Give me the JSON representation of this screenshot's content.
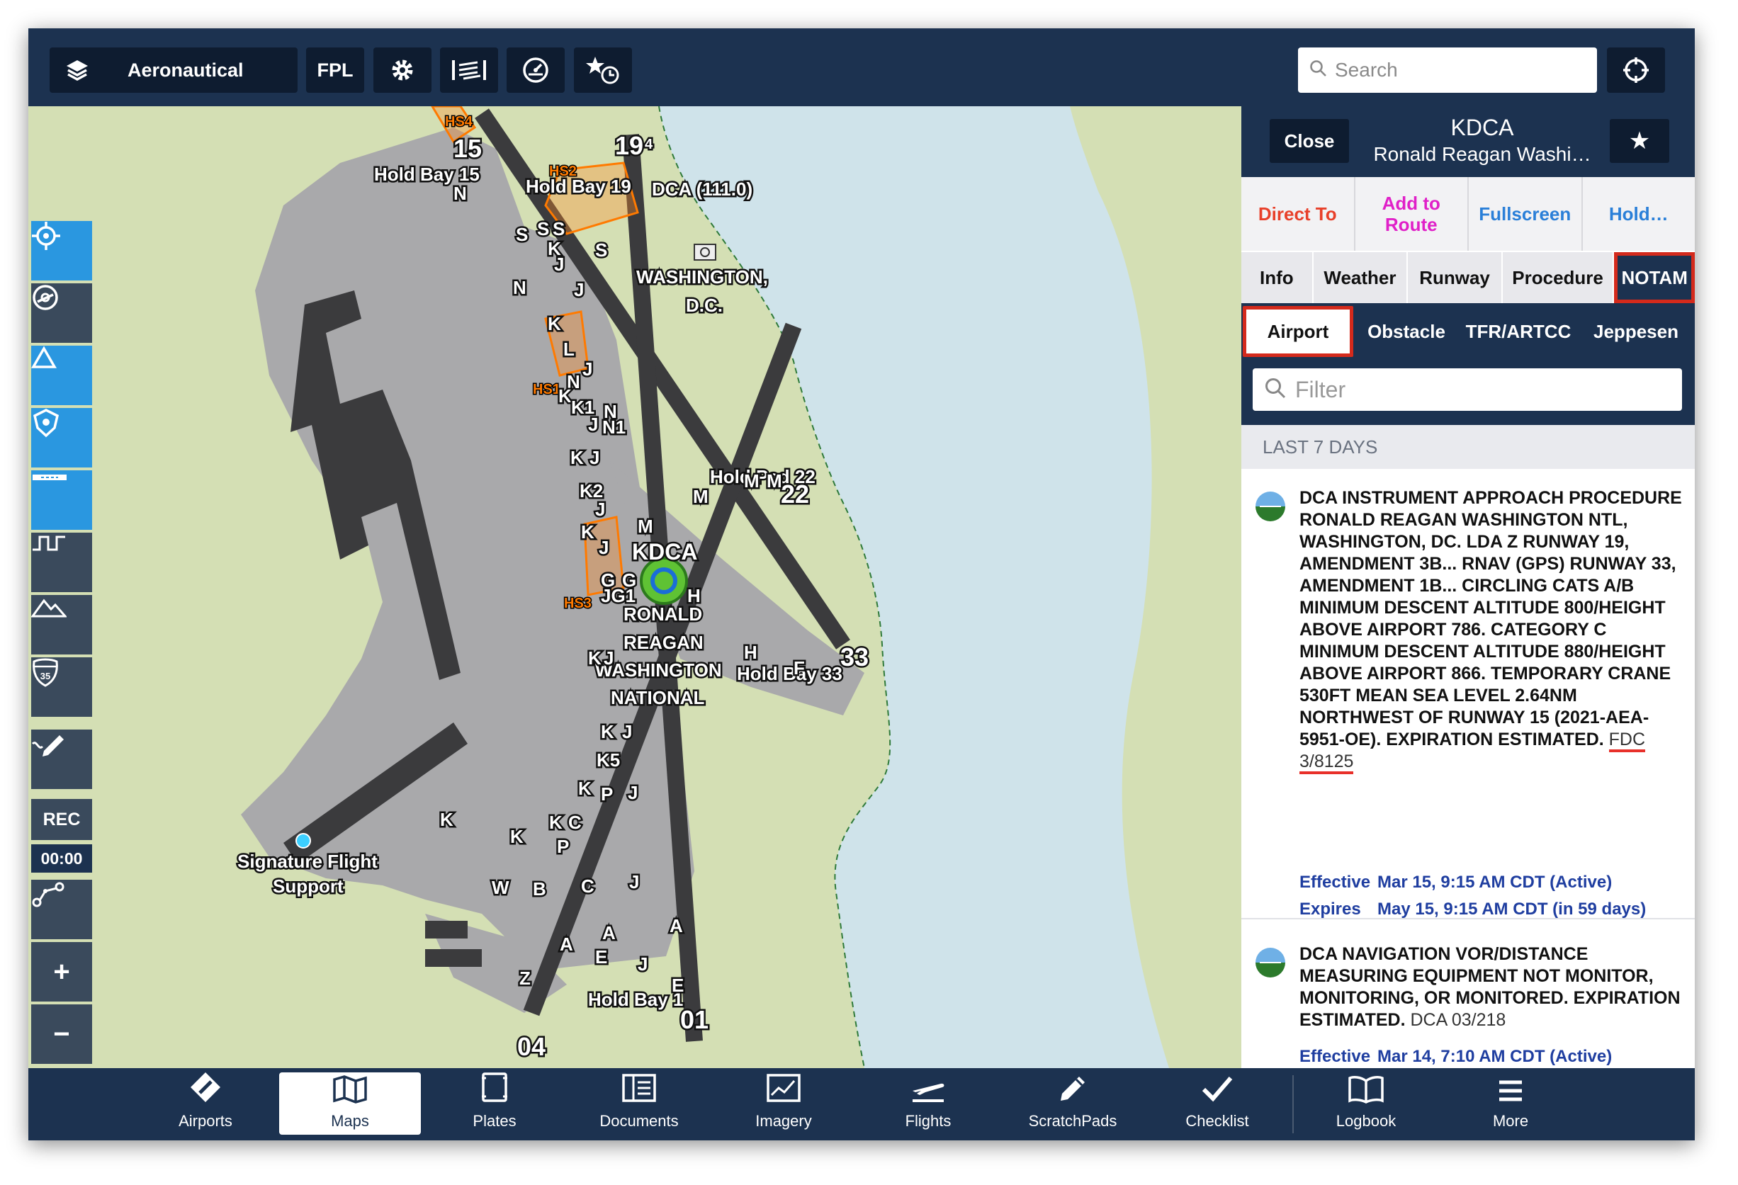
{
  "topbar": {
    "layer_label": "Aeronautical",
    "fpl_label": "FPL",
    "search_placeholder": "Search"
  },
  "map": {
    "labels": {
      "hold_bay_15": "Hold Bay 15",
      "hold_bay_19": "Hold Bay 19",
      "hold_bay_1": "Hold Bay 1",
      "hold_bay_33": "Hold Bay 33",
      "hold_pad_22": "Hold Pad 22",
      "dca_vor": "DCA (111.0)",
      "city_1": "WASHINGTON,",
      "city_2": "D.C.",
      "airport_id": "KDCA",
      "airport_name_1": "RONALD",
      "airport_name_2": "REAGAN",
      "airport_name_3": "WASHINGTON",
      "airport_name_4": "NATIONAL",
      "fbo_1": "Signature Flight",
      "fbo_2": "Support",
      "rwy_15": "15",
      "rwy_19": "19",
      "rwy_19_suffix": "4",
      "rwy_22": "22",
      "rwy_33": "33",
      "rwy_04": "04",
      "rwy_01": "01",
      "hs1": "HS1",
      "hs2": "HS2",
      "hs3": "HS3",
      "hs4": "HS4"
    },
    "taxiways": [
      {
        "t": "N"
      },
      {
        "t": "S"
      },
      {
        "t": "S"
      },
      {
        "t": "S"
      },
      {
        "t": "K"
      },
      {
        "t": "S"
      },
      {
        "t": "J"
      },
      {
        "t": "N"
      },
      {
        "t": "J"
      },
      {
        "t": "K"
      },
      {
        "t": "L"
      },
      {
        "t": "J"
      },
      {
        "t": "N"
      },
      {
        "t": "K"
      },
      {
        "t": "K1"
      },
      {
        "t": "N"
      },
      {
        "t": "N1"
      },
      {
        "t": "J"
      },
      {
        "t": "K"
      },
      {
        "t": "J"
      },
      {
        "t": "K2"
      },
      {
        "t": "M"
      },
      {
        "t": "M"
      },
      {
        "t": "M"
      },
      {
        "t": "J"
      },
      {
        "t": "M"
      },
      {
        "t": "K"
      },
      {
        "t": "J"
      },
      {
        "t": "G"
      },
      {
        "t": "G"
      },
      {
        "t": "JG1"
      },
      {
        "t": "H"
      },
      {
        "t": "H"
      },
      {
        "t": "K"
      },
      {
        "t": "J"
      },
      {
        "t": "F"
      },
      {
        "t": "K"
      },
      {
        "t": "J"
      },
      {
        "t": "K5"
      },
      {
        "t": "K"
      },
      {
        "t": "P"
      },
      {
        "t": "J"
      },
      {
        "t": "K"
      },
      {
        "t": "K"
      },
      {
        "t": "K"
      },
      {
        "t": "C"
      },
      {
        "t": "P"
      },
      {
        "t": "W"
      },
      {
        "t": "B"
      },
      {
        "t": "C"
      },
      {
        "t": "J"
      },
      {
        "t": "A"
      },
      {
        "t": "A"
      },
      {
        "t": "A"
      },
      {
        "t": "E"
      },
      {
        "t": "J"
      },
      {
        "t": "E"
      },
      {
        "t": "Z"
      }
    ]
  },
  "left_toolbar": {
    "rec_label": "REC",
    "timer": "00:00",
    "zoom_in": "+",
    "zoom_out": "−",
    "shield_number": "35"
  },
  "panel": {
    "close_label": "Close",
    "airport_id": "KDCA",
    "airport_name": "Ronald Reagan Washi…",
    "actions": [
      {
        "label": "Direct To",
        "color": "#e8402a"
      },
      {
        "label": "Add to Route",
        "color": "#e020c8"
      },
      {
        "label": "Fullscreen",
        "color": "#2a7fd8"
      },
      {
        "label": "Hold…",
        "color": "#2a7fd8"
      }
    ],
    "tabs": [
      "Info",
      "Weather",
      "Runway",
      "Procedure",
      "NOTAM"
    ],
    "subtabs": [
      "Airport",
      "Obstacle",
      "TFR/ARTCC",
      "Jeppesen"
    ],
    "filter_placeholder": "Filter",
    "section_label": "LAST 7 DAYS",
    "notams": [
      {
        "text": "DCA INSTRUMENT APPROACH PROCEDURE RONALD REAGAN WASHINGTON NTL, WASHINGTON, DC. LDA Z RUNWAY 19, AMENDMENT 3B... RNAV (GPS) RUNWAY 33, AMENDMENT 1B... CIRCLING CATS A/B MINIMUM DESCENT ALTITUDE 800/HEIGHT ABOVE AIRPORT 786. CATEGORY C MINIMUM DESCENT ALTITUDE 880/HEIGHT ABOVE AIRPORT 866. TEMPORARY CRANE 530FT MEAN SEA LEVEL 2.64NM NORTHWEST OF RUNWAY 15 (2021-AEA-5951-OE). EXPIRATION ESTIMATED.",
        "ref": "FDC 3/8125",
        "effective_label": "Effective",
        "effective": "Mar 15, 9:15 AM CDT (Active)",
        "expires_label": "Expires",
        "expires": "May 15, 9:15 AM CDT (in 59 days)"
      },
      {
        "text": "DCA NAVIGATION VOR/DISTANCE MEASURING EQUIPMENT NOT MONITOR, MONITORING, OR MONITORED. EXPIRATION ESTIMATED.",
        "ref": "DCA 03/218",
        "effective_label": "Effective",
        "effective": "Mar 14, 7:10 AM CDT (Active)"
      }
    ]
  },
  "bottombar": {
    "items": [
      {
        "label": "Airports"
      },
      {
        "label": "Maps"
      },
      {
        "label": "Plates"
      },
      {
        "label": "Documents"
      },
      {
        "label": "Imagery"
      },
      {
        "label": "Flights"
      },
      {
        "label": "ScratchPads"
      },
      {
        "label": "Checklist"
      },
      {
        "label": "Logbook"
      },
      {
        "label": "More"
      }
    ]
  },
  "colors": {
    "nav_bg": "#1c3250",
    "button_bg": "#0e1c30",
    "land": "#d4dfb4",
    "water": "#cfe3ea",
    "apron": "#a9a9ab",
    "runway": "#3b3b3d",
    "accent_blue": "#2a97e0",
    "highlight_red": "#d42a1c"
  }
}
